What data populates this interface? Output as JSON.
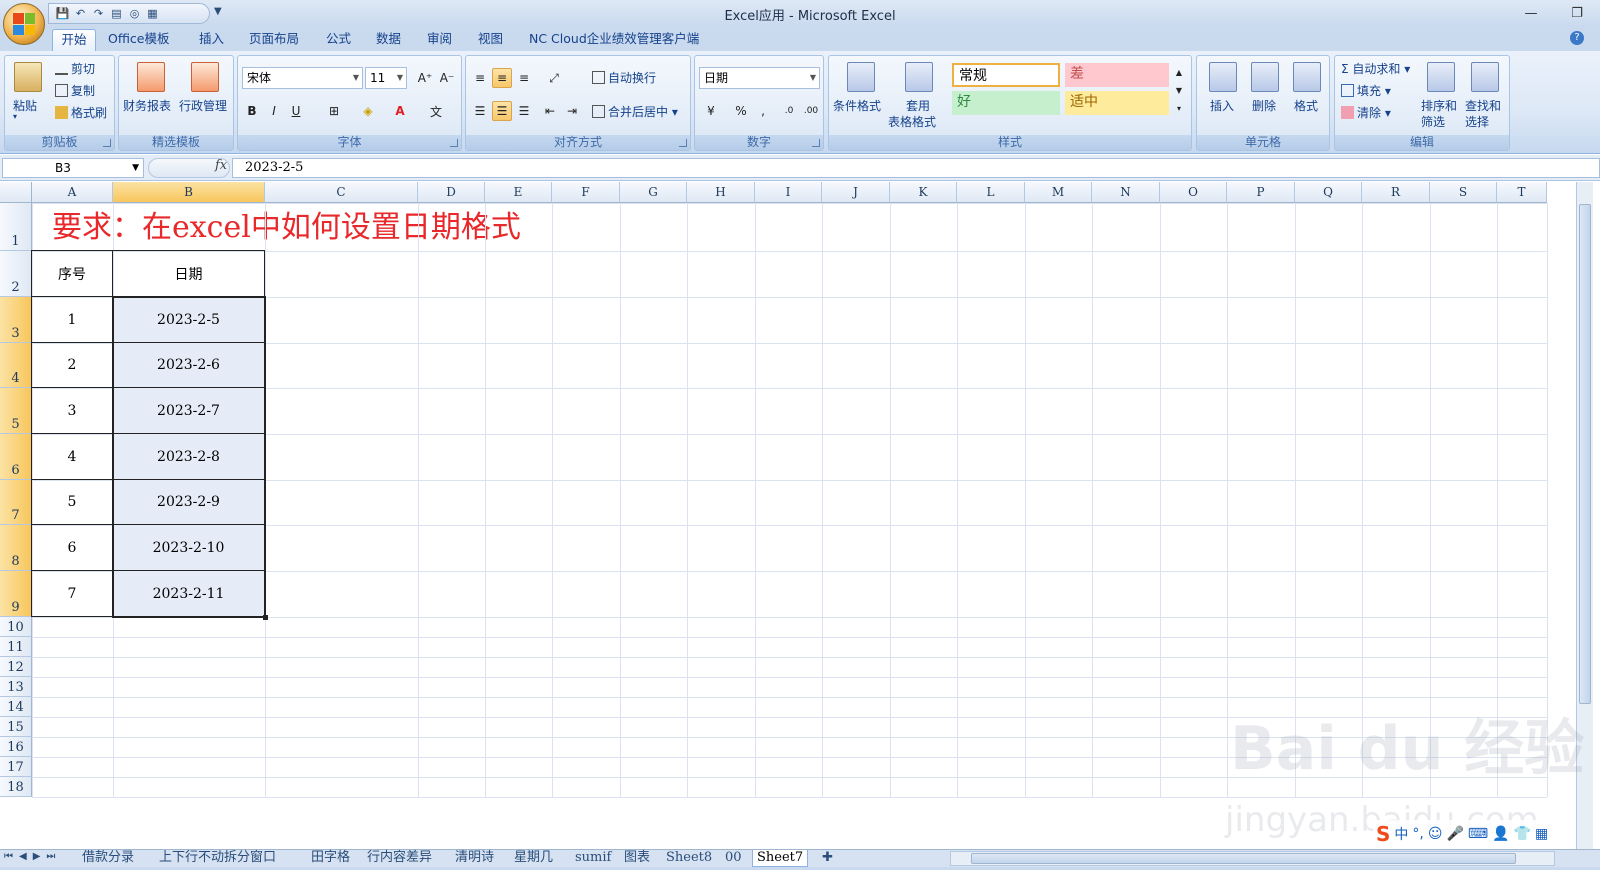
{
  "window": {
    "title": "Excel应用 - Microsoft Excel"
  },
  "ribbon_tabs": [
    {
      "label": "开始",
      "active": true
    },
    {
      "label": "Office模板"
    },
    {
      "label": "插入"
    },
    {
      "label": "页面布局"
    },
    {
      "label": "公式"
    },
    {
      "label": "数据"
    },
    {
      "label": "审阅"
    },
    {
      "label": "视图"
    },
    {
      "label": "NC Cloud企业绩效管理客户端"
    }
  ],
  "clipboard": {
    "paste": "粘贴",
    "cut": "剪切",
    "copy": "复制",
    "format_painter": "格式刷",
    "group": "剪贴板"
  },
  "templates": {
    "finance": "财务报表",
    "admin": "行政管理",
    "group": "精选模板"
  },
  "font": {
    "name": "宋体",
    "size": "11",
    "group": "字体"
  },
  "alignment": {
    "wrap": "自动换行",
    "merge": "合并后居中",
    "group": "对齐方式"
  },
  "number": {
    "format": "日期",
    "group": "数字"
  },
  "styles": {
    "conditional": "条件格式",
    "table_line1": "套用",
    "table_line2": "表格格式",
    "normal": "常规",
    "bad": "差",
    "good": "好",
    "neutral": "适中",
    "group": "样式"
  },
  "cells_group": {
    "insert": "插入",
    "delete": "删除",
    "format": "格式",
    "group": "单元格"
  },
  "editing": {
    "autosum": "自动求和",
    "fill": "填充",
    "clear": "清除",
    "sort_line1": "排序和",
    "sort_line2": "筛选",
    "find_line1": "查找和",
    "find_line2": "选择",
    "group": "编辑"
  },
  "formula_bar": {
    "name_box": "B3",
    "fx": "fx",
    "value": "2023-2-5"
  },
  "columns": [
    "A",
    "B",
    "C",
    "D",
    "E",
    "F",
    "G",
    "H",
    "I",
    "J",
    "K",
    "L",
    "M",
    "N",
    "O",
    "P",
    "Q",
    "R",
    "S",
    "T"
  ],
  "rows": [
    "1",
    "2",
    "3",
    "4",
    "5",
    "6",
    "7",
    "8",
    "9",
    "10",
    "11",
    "12",
    "13",
    "14",
    "15",
    "16",
    "17",
    "18"
  ],
  "sheet": {
    "title": "要求：在excel中如何设置日期格式",
    "headers": [
      "序号",
      "日期"
    ],
    "data": [
      [
        "1",
        "2023-2-5"
      ],
      [
        "2",
        "2023-2-6"
      ],
      [
        "3",
        "2023-2-7"
      ],
      [
        "4",
        "2023-2-8"
      ],
      [
        "5",
        "2023-2-9"
      ],
      [
        "6",
        "2023-2-10"
      ],
      [
        "7",
        "2023-2-11"
      ]
    ]
  },
  "sheet_tabs": [
    "借款分录",
    "上下行不动拆分窗口",
    "田字格",
    "行内容差异",
    "清明诗",
    "星期几",
    "sumif",
    "图表",
    "Sheet8",
    "00",
    "Sheet7"
  ],
  "active_sheet": "Sheet7",
  "watermark": {
    "line1": "Bai du 经验",
    "line2": "jingyan.baidu.com"
  },
  "tray": {
    "ime": "中"
  },
  "colors": {
    "accent": "#15428b",
    "title_red": "#e8282a",
    "selection": "#f8c65c"
  }
}
